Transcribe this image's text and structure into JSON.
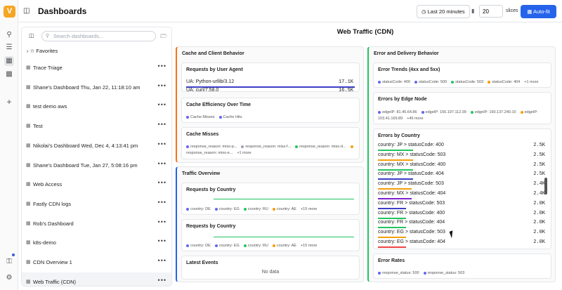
{
  "rail": {
    "logo": "V",
    "icons": [
      "search-icon",
      "filter-icon",
      "dashboard-icon",
      "chart-icon",
      "plus-icon",
      "key-icon",
      "settings-icon"
    ]
  },
  "topbar": {
    "title": "Dashboards",
    "time_label": "Last 20 minutes",
    "slices_value": "20",
    "slices_label": "slices",
    "autofit_label": "Auto-fit"
  },
  "sidebar": {
    "search_placeholder": "Search dashboards...",
    "favorites_label": "Favorites",
    "items": [
      {
        "name": "Trace Triage"
      },
      {
        "name": "Shane's Dashboard Thu, Jan 22, 11:18:10 am"
      },
      {
        "name": "test demo aws"
      },
      {
        "name": "Test"
      },
      {
        "name": "Nikolai's Dashboard Wed, Dec 4, 4:13:41 pm"
      },
      {
        "name": "Shane's Dashboard Tue, Jan 27, 5:08:16 pm"
      },
      {
        "name": "Web Access"
      },
      {
        "name": "Fastly CDN logs"
      },
      {
        "name": "Rob's Dashboard"
      },
      {
        "name": "k8s-demo"
      },
      {
        "name": "CDN Overview 1"
      },
      {
        "name": "Web Traffic (CDN)"
      }
    ],
    "more_label": "•••"
  },
  "main": {
    "title": "Web Traffic (CDN)",
    "cache_group": {
      "title": "Cache and Client Behavior",
      "ua_card": {
        "title": "Requests by User Agent",
        "rows": [
          {
            "label": "UA: Python-urllib/3.12",
            "value": "17.1K",
            "color": "#3b3fc4"
          },
          {
            "label": "UA: curl/7.58.0",
            "value": "16.5K",
            "color": "#3b3fc4"
          }
        ]
      },
      "eff_card": {
        "title": "Cache Efficiency Over Time",
        "legend": [
          {
            "label": "Cache Misses",
            "color": "#6366f1"
          },
          {
            "label": "Cache Hits",
            "color": "#6366f1"
          }
        ]
      },
      "miss_card": {
        "title": "Cache Misses",
        "legend": [
          {
            "label": "response_reason: miss-p...",
            "color": "#6366f1"
          },
          {
            "label": "response_reason: miss-f...",
            "color": "#9ca3af"
          },
          {
            "label": "response_reason: miss-d...",
            "color": "#22c55e"
          },
          {
            "label": "response_reason: miss-e...",
            "color": "#f59e0b"
          }
        ],
        "more": "+1 more"
      }
    },
    "traffic_group": {
      "title": "Traffic Overview",
      "country_card_1": {
        "title": "Requests by Country",
        "legend": [
          {
            "label": "country: DE",
            "color": "#6366f1"
          },
          {
            "label": "country: EG",
            "color": "#6366f1"
          },
          {
            "label": "country: RU",
            "color": "#22c55e"
          },
          {
            "label": "country: AE",
            "color": "#f59e0b"
          }
        ],
        "more": "+15 more"
      },
      "country_card_2": {
        "title": "Requests by Country",
        "legend": [
          {
            "label": "country: DE",
            "color": "#6366f1"
          },
          {
            "label": "country: EG",
            "color": "#6366f1"
          },
          {
            "label": "country: RU",
            "color": "#22c55e"
          },
          {
            "label": "country: AE",
            "color": "#f59e0b"
          }
        ],
        "more": "+15 more"
      },
      "events_card": {
        "title": "Latest Events",
        "empty": "No data"
      }
    },
    "error_group": {
      "title": "Error and Delivery Behavior",
      "trends_card": {
        "title": "Error Trends (4xx and 5xx)",
        "legend": [
          {
            "label": "statusCode: 400",
            "color": "#6366f1"
          },
          {
            "label": "statusCode: 500",
            "color": "#6366f1"
          },
          {
            "label": "statusCode: 503",
            "color": "#22c55e"
          },
          {
            "label": "statusCode: 404",
            "color": "#f59e0b"
          }
        ],
        "more": "+1 more"
      },
      "edge_card": {
        "title": "Errors by Edge Node",
        "legend": [
          {
            "label": "edgeIP: 81.45.64.86",
            "color": "#6366f1"
          },
          {
            "label": "edgeIP: 156.197.112.99",
            "color": "#6366f1"
          },
          {
            "label": "edgeIP: 190.137.240.10",
            "color": "#22c55e"
          },
          {
            "label": "edgeIP: 103.41.169.89",
            "color": "#f59e0b"
          }
        ],
        "more": "+46 more"
      },
      "country_err_card": {
        "title": "Errors by Country",
        "rows": [
          {
            "label": "country: JP > statusCode: 400",
            "value": "2.5K",
            "color": "#22c55e"
          },
          {
            "label": "country: MX > statusCode: 503",
            "value": "2.5K",
            "color": "#f59e0b"
          },
          {
            "label": "country: MX > statusCode: 400",
            "value": "2.5K",
            "color": "#22c55e"
          },
          {
            "label": "country: JP > statusCode: 404",
            "value": "2.5K",
            "color": "#3b3fc4"
          },
          {
            "label": "country: JP > statusCode: 503",
            "value": "2.4K",
            "color": "#f59e0b"
          },
          {
            "label": "country: MX > statusCode: 404",
            "value": "2.4K",
            "color": "#7e22ce"
          },
          {
            "label": "country: FR > statusCode: 503",
            "value": "2.0K",
            "color": "#3b3fc4"
          },
          {
            "label": "country: FR > statusCode: 400",
            "value": "2.0K",
            "color": "#22c55e"
          },
          {
            "label": "country: FR > statusCode: 404",
            "value": "2.0K",
            "color": "#22c55e"
          },
          {
            "label": "country: EG > statusCode: 503",
            "value": "2.0K",
            "color": "#f59e0b"
          },
          {
            "label": "country: EG > statusCode: 404",
            "value": "2.0K",
            "color": "#ef4444"
          }
        ]
      },
      "rates_card": {
        "title": "Error Rates",
        "legend": [
          {
            "label": "response_status: 500",
            "color": "#6366f1"
          },
          {
            "label": "response_status: 503",
            "color": "#6366f1"
          }
        ]
      }
    }
  }
}
